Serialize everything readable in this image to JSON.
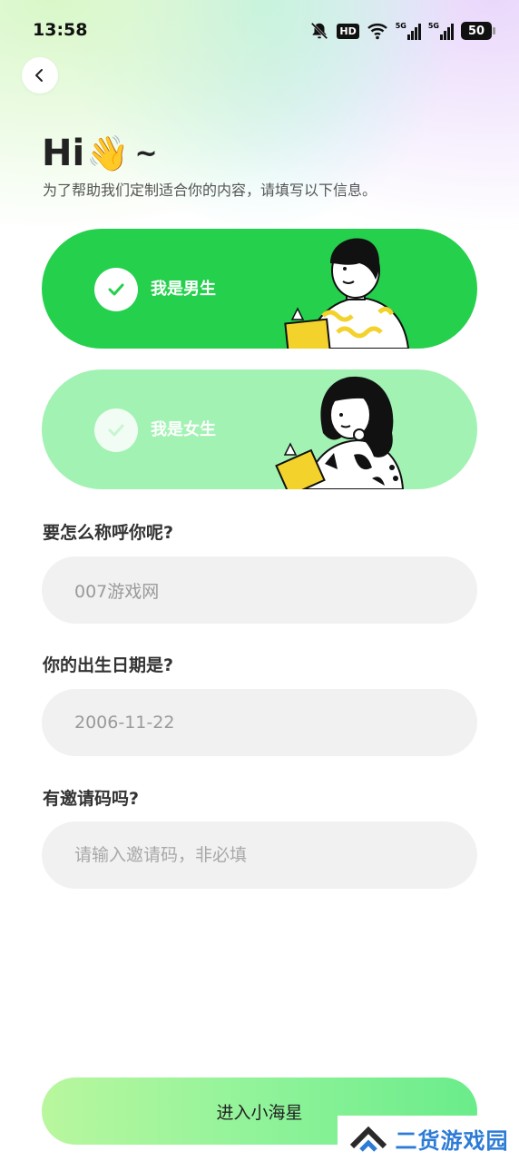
{
  "status_bar": {
    "time": "13:58",
    "hd_label": "HD",
    "net_1": "5G",
    "net_2": "5G",
    "battery": "50"
  },
  "header": {
    "greeting": "Hi",
    "wave_emoji": "👋",
    "tilde": "~",
    "subtitle": "为了帮助我们定制适合你的内容，请填写以下信息。"
  },
  "gender": {
    "male_label": "我是男生",
    "female_label": "我是女生",
    "selected": "male",
    "colors": {
      "male_bg": "#24d04c",
      "female_bg": "#a2f2b3"
    }
  },
  "form": {
    "name_question": "要怎么称呼你呢?",
    "name_value": "007游戏网",
    "birth_question": "你的出生日期是?",
    "birth_value": "2006-11-22",
    "invite_question": "有邀请码吗?",
    "invite_placeholder": "请输入邀请码，非必填"
  },
  "enter_button_label": "进入小海星",
  "watermark_text": "二货游戏园"
}
